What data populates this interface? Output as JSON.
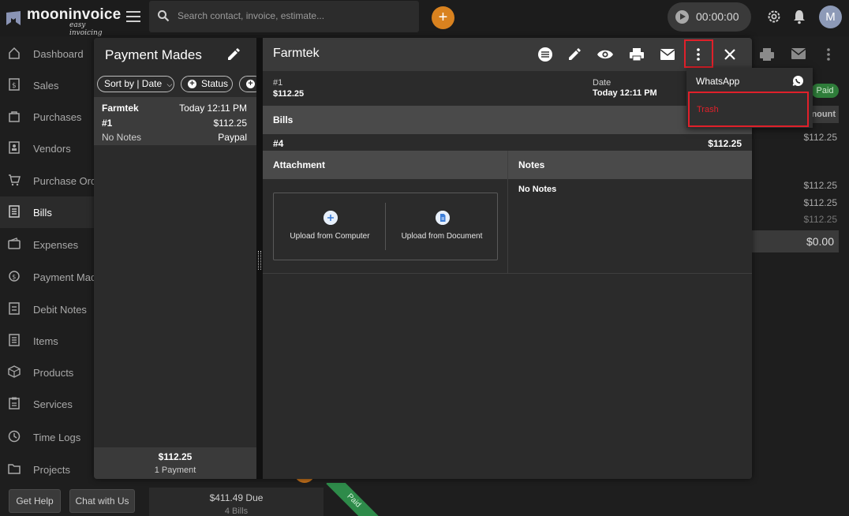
{
  "app": {
    "logo_name": "mooninvoice",
    "logo_tagline": "easy invoicing",
    "search_placeholder": "Search contact, invoice, estimate...",
    "add_label": "+",
    "timer": "00:00:00",
    "avatar_initial": "M"
  },
  "sidebar": {
    "items": [
      {
        "label": "Dashboard",
        "icon": "home-icon"
      },
      {
        "label": "Sales",
        "icon": "dollar-doc-icon"
      },
      {
        "label": "Purchases",
        "icon": "bag-icon"
      },
      {
        "label": "Vendors",
        "icon": "contact-card-icon"
      },
      {
        "label": "Purchase Ord",
        "icon": "cart-icon"
      },
      {
        "label": "Bills",
        "icon": "list-doc-icon"
      },
      {
        "label": "Expenses",
        "icon": "wallet-icon"
      },
      {
        "label": "Payment Mad",
        "icon": "payment-icon"
      },
      {
        "label": "Debit Notes",
        "icon": "note-icon"
      },
      {
        "label": "Items",
        "icon": "list-icon"
      },
      {
        "label": "Products",
        "icon": "box-icon"
      },
      {
        "label": "Services",
        "icon": "clipboard-icon"
      },
      {
        "label": "Time Logs",
        "icon": "clock-icon"
      },
      {
        "label": "Projects",
        "icon": "folder-icon"
      }
    ],
    "active_index": 5,
    "help_label": "Get Help",
    "chat_label": "Chat with Us"
  },
  "background": {
    "paid_badge": "Paid",
    "amount_header": "nount",
    "row_amount": "$112.25",
    "values": [
      "$112.25",
      "$112.25",
      "$112.25"
    ],
    "total": "$0.00",
    "due": "$411.49  Due",
    "bills_count": "4 Bills",
    "ribbon": "Paid"
  },
  "list_panel": {
    "title": "Payment Mades",
    "sort_label": "Sort by | Date",
    "status_label": "Status",
    "payment": {
      "vendor": "Farmtek",
      "time": "Today 12:11 PM",
      "number": "#1",
      "amount": "$112.25",
      "notes": "No Notes",
      "method": "Paypal"
    },
    "footer_total": "$112.25",
    "footer_count": "1 Payment"
  },
  "detail": {
    "title": "Farmtek",
    "number_label": "#1",
    "amount": "$112.25",
    "date_label": "Date",
    "date_value": "Today 12:11 PM",
    "bills_header": "Bills",
    "bill_number": "#4",
    "bill_amount": "$112.25",
    "attachment_header": "Attachment",
    "notes_header": "Notes",
    "notes_value": "No Notes",
    "upload_computer": "Upload from Computer",
    "upload_document": "Upload from Document"
  },
  "menu": {
    "whatsapp": "WhatsApp",
    "trash": "Trash"
  },
  "colors": {
    "accent_orange": "#d9821f",
    "highlight_red": "#e0202a",
    "paid_green": "#2f7d3a"
  }
}
